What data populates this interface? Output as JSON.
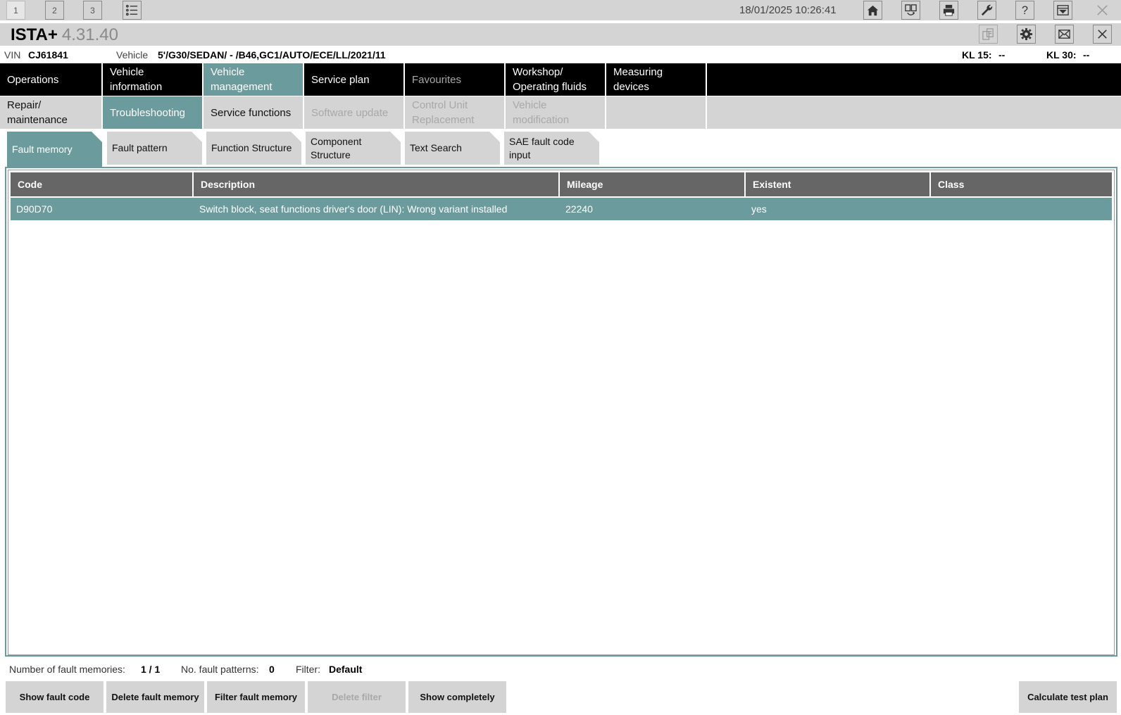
{
  "topbar": {
    "workspaces": [
      "1",
      "2",
      "3"
    ],
    "datetime": "18/01/2025 10:26:41"
  },
  "titlebar": {
    "app_name": "ISTA+",
    "version": "4.31.40"
  },
  "vehicle": {
    "vin_label": "VIN",
    "vin": "CJ61841",
    "vehicle_label": "Vehicle",
    "vehicle": "5'/G30/SEDAN/ - /B46,GC1/AUTO/ECE/LL/2021/11",
    "kl15_label": "KL 15:",
    "kl15": "--",
    "kl30_label": "KL 30:",
    "kl30": "--"
  },
  "main_nav": [
    {
      "label": "Operations"
    },
    {
      "label": "Vehicle information"
    },
    {
      "label": "Vehicle management"
    },
    {
      "label": "Service plan"
    },
    {
      "label": "Favourites"
    },
    {
      "label": "Workshop/ Operating fluids"
    },
    {
      "label": "Measuring devices"
    }
  ],
  "sub_nav": [
    {
      "label": "Repair/ maintenance"
    },
    {
      "label": "Troubleshooting"
    },
    {
      "label": "Service functions"
    },
    {
      "label": "Software update"
    },
    {
      "label": "Control Unit Replacement"
    },
    {
      "label": "Vehicle modification"
    }
  ],
  "fault_tabs": [
    {
      "label": "Fault memory"
    },
    {
      "label": "Fault pattern"
    },
    {
      "label": "Function Structure"
    },
    {
      "label": "Component Structure"
    },
    {
      "label": "Text Search"
    },
    {
      "label": "SAE fault code input"
    }
  ],
  "table": {
    "columns": [
      "Code",
      "Description",
      "Mileage",
      "Existent",
      "Class"
    ],
    "rows": [
      {
        "code": "D90D70",
        "description": "Switch block, seat functions driver's door (LIN): Wrong variant installed",
        "mileage": "22240",
        "existent": "yes",
        "class": ""
      }
    ]
  },
  "stats": {
    "fault_memories_label": "Number of fault memories:",
    "fault_memories": "1 / 1",
    "fault_patterns_label": "No. fault patterns:",
    "fault_patterns": "0",
    "filter_label": "Filter:",
    "filter": "Default"
  },
  "buttons": {
    "show_fault_code": "Show fault code",
    "delete_fault_memory": "Delete fault memory",
    "filter_fault_memory": "Filter fault memory",
    "delete_filter": "Delete filter",
    "show_completely": "Show completely",
    "calculate_test_plan": "Calculate test plan"
  },
  "colors": {
    "accent": "#6b9b9c",
    "panel": "#d4d4d4",
    "header": "#666666"
  }
}
